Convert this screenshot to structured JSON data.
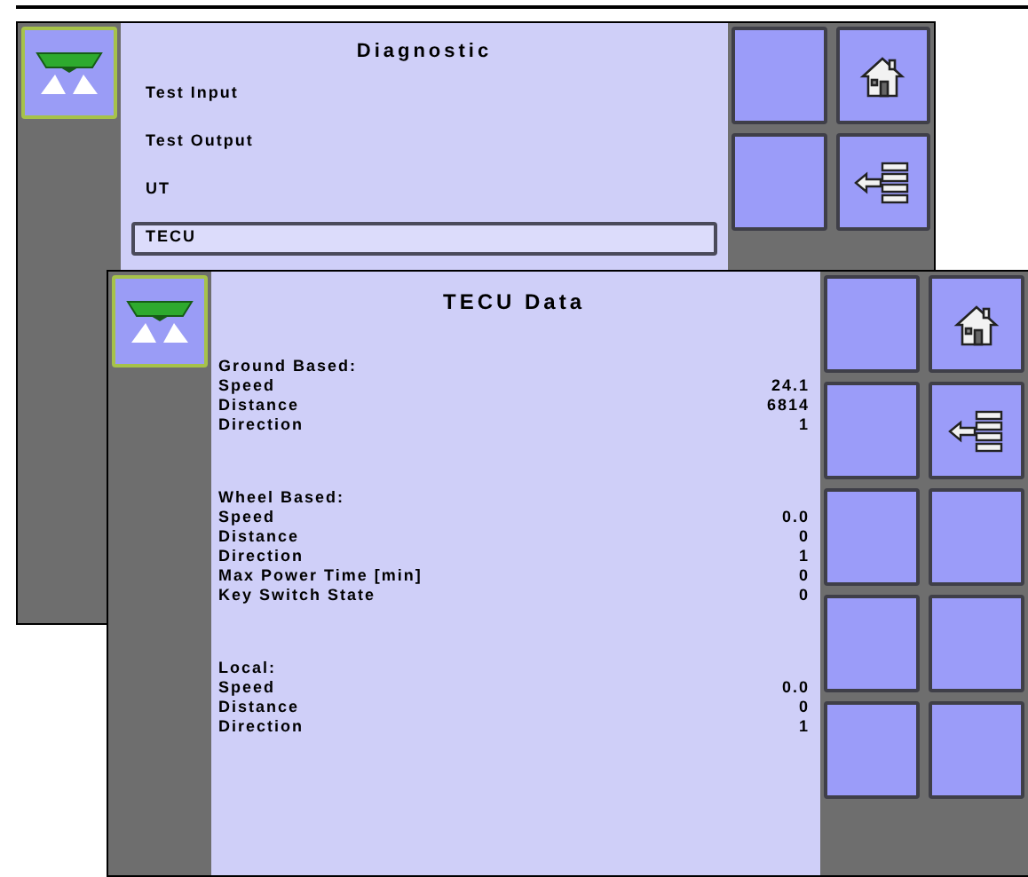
{
  "back_screen": {
    "title": "Diagnostic",
    "items": [
      {
        "label": "Test Input",
        "selected": false
      },
      {
        "label": "Test Output",
        "selected": false
      },
      {
        "label": "UT",
        "selected": false
      },
      {
        "label": "TECU",
        "selected": true
      }
    ],
    "buttons": [
      {
        "kind": "blank"
      },
      {
        "kind": "home"
      },
      {
        "kind": "blank"
      },
      {
        "kind": "back-list"
      }
    ]
  },
  "front_screen": {
    "title": "TECU Data",
    "sections": [
      {
        "heading": "Ground Based:",
        "rows": [
          {
            "label": "Speed",
            "value": "24.1"
          },
          {
            "label": "Distance",
            "value": "6814"
          },
          {
            "label": "Direction",
            "value": "1"
          }
        ]
      },
      {
        "heading": "Wheel Based:",
        "rows": [
          {
            "label": "Speed",
            "value": "0.0"
          },
          {
            "label": "Distance",
            "value": "0"
          },
          {
            "label": "Direction",
            "value": "1"
          },
          {
            "label": "Max Power Time [min]",
            "value": "0"
          },
          {
            "label": "Key Switch State",
            "value": "0"
          }
        ]
      },
      {
        "heading": "Local:",
        "rows": [
          {
            "label": "Speed",
            "value": "0.0"
          },
          {
            "label": "Distance",
            "value": "0"
          },
          {
            "label": "Direction",
            "value": "1"
          }
        ]
      }
    ],
    "buttons": [
      {
        "kind": "blank"
      },
      {
        "kind": "home"
      },
      {
        "kind": "blank"
      },
      {
        "kind": "back-list"
      },
      {
        "kind": "blank"
      },
      {
        "kind": "blank"
      },
      {
        "kind": "blank"
      },
      {
        "kind": "blank"
      },
      {
        "kind": "blank"
      },
      {
        "kind": "blank"
      }
    ]
  }
}
